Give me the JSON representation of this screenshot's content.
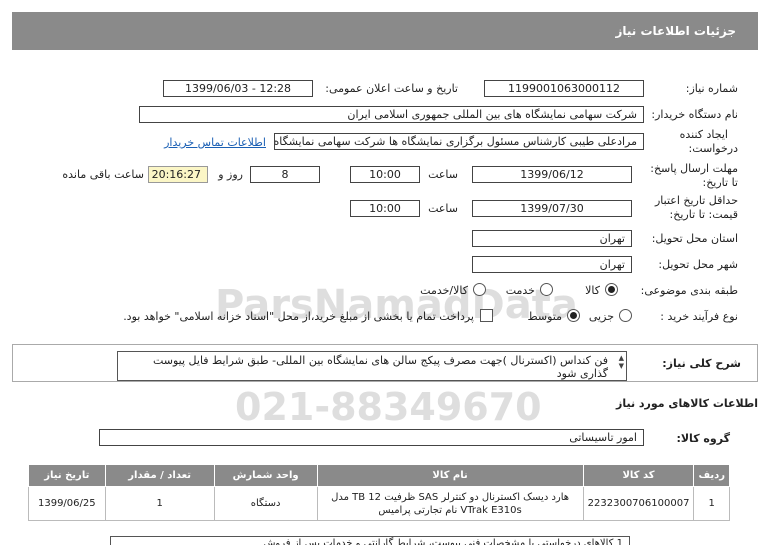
{
  "header": {
    "title": "جزئیات اطلاعات نیاز"
  },
  "form": {
    "need_number_label": "شماره نیاز:",
    "need_number": "1199001063000112",
    "announce_label": "تاریخ و ساعت اعلان عمومی:",
    "announce_value": "1399/06/03 - 12:28",
    "buyer_label": "نام دستگاه خریدار:",
    "buyer_value": "شرکت سهامی نمایشگاه های بین المللی جمهوری اسلامی ایران",
    "creator_label_1": "ایجاد کننده",
    "creator_label_2": "درخواست:",
    "creator_value": "مرادعلی طیبی کارشناس مسئول برگزاری نمایشگاه ها شرکت سهامی نمایشگاه",
    "contact_link": "اطلاعات تماس خریدار",
    "deadline_label_1": "مهلت ارسال پاسخ:",
    "deadline_label_2": "تا تاریخ:",
    "deadline_date": "1399/06/12",
    "time_label": "ساعت",
    "deadline_time": "10:00",
    "days_value": "8",
    "days_label": "روز و",
    "remaining_time": "20:16:27",
    "remaining_label": "ساعت باقی مانده",
    "validity_label_1": "حداقل تاریخ اعتبار",
    "validity_label_2": "قیمت: تا تاریخ:",
    "validity_date": "1399/07/30",
    "validity_time": "10:00",
    "province_label": "استان محل تحویل:",
    "province_value": "تهران",
    "city_label": "شهر محل تحویل:",
    "city_value": "تهران",
    "category_label": "طبقه بندی موضوعی:",
    "category_options": [
      "کالا",
      "خدمت",
      "کالا/خدمت"
    ],
    "process_label": "نوع فرآیند خرید :",
    "process_options": [
      "جزیی",
      "متوسط"
    ],
    "payment_note": "پرداخت تمام یا بخشی از مبلغ خرید،از محل \"اسناد خزانه اسلامی\" خواهد بود."
  },
  "description": {
    "label": "شرح کلی نیاز:",
    "text": "فن کنداس (اکسترنال )جهت مصرف پیکج سالن های نمایشگاه  بین المللی- طبق شرایط فایل پیوست گذاری شود"
  },
  "goods_section_title": "اطلاعات کالاهای مورد نیاز",
  "goods_group_label": "گروه کالا:",
  "goods_group_value": "امور تاسیساتی",
  "table": {
    "headers": [
      "ردیف",
      "کد کالا",
      "نام کالا",
      "واحد شمارش",
      "تعداد / مقدار",
      "تاریخ نیاز"
    ],
    "rows": [
      {
        "row": "1",
        "code": "2232300706100007",
        "name_1": "هارد دیسک اکسترنال دو کنترلر SAS ظرفیت 12 TB مدل",
        "name_2": "VTrak E310s نام تجارتی پرامیس",
        "unit": "دستگاه",
        "qty": "1",
        "date": "1399/06/25"
      }
    ]
  },
  "bottom_note": "1 کالاهای درخواستی با مشخصات فنی پیوست، شرایط گارانتی و خدمات پس از فروش"
}
